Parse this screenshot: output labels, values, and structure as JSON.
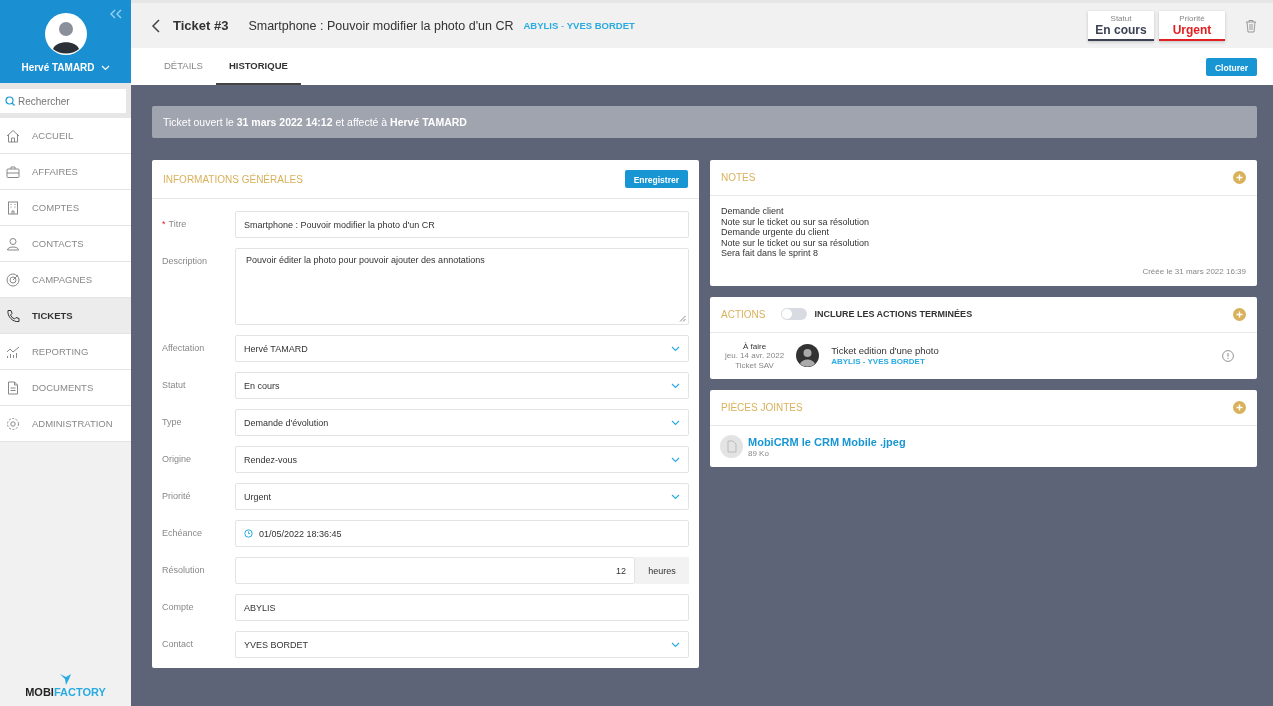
{
  "sidebar": {
    "user_name": "Hervé TAMARD",
    "search": {
      "placeholder": "Rechercher"
    },
    "items": [
      {
        "label": "ACCUEIL",
        "selected": false
      },
      {
        "label": "AFFAIRES",
        "selected": false
      },
      {
        "label": "COMPTES",
        "selected": false
      },
      {
        "label": "CONTACTS",
        "selected": false
      },
      {
        "label": "CAMPAGNES",
        "selected": false
      },
      {
        "label": "TICKETS",
        "selected": true
      },
      {
        "label": "REPORTING",
        "selected": false
      },
      {
        "label": "DOCUMENTS",
        "selected": false
      },
      {
        "label": "ADMINISTRATION",
        "selected": false
      }
    ],
    "logo": {
      "part_1": "MOBI",
      "part_2": "FACTORY"
    }
  },
  "header": {
    "ticket_number": "Ticket #3",
    "title": "Smartphone : Pouvoir modifier la photo d'un CR",
    "company_link": "ABYLIS",
    "separator": " - ",
    "contact_link": "YVES BORDET",
    "badges": [
      {
        "label": "Statut",
        "value": "En cours",
        "color": "#3b4253"
      },
      {
        "label": "Priorité",
        "value": "Urgent",
        "color": "#e02020"
      }
    ]
  },
  "tabs": [
    {
      "label": "DÉTAILS",
      "selected": false
    },
    {
      "label": "HISTORIQUE",
      "selected": true
    }
  ],
  "close_button": "Cloturer",
  "banner": "Ticket ouvert le **31 mars 2022 14:12** et affecté à **Hervé TAMARD**",
  "general_info": {
    "title": "INFORMATIONS GÉNÉRALES",
    "save_button": "Enregistrer",
    "fields": [
      {
        "kind": "text",
        "label": "Titre",
        "required_mark": "*",
        "value": "Smartphone : Pouvoir modifier la photo d'un CR"
      },
      {
        "kind": "textarea",
        "label": "Description",
        "value": "Pouvoir éditer la photo pour  pouvoir ajouter des annotations"
      },
      {
        "kind": "select",
        "label": "Affectation",
        "value": "Hervé TAMARD"
      },
      {
        "kind": "select",
        "label": "Statut",
        "value": "En cours"
      },
      {
        "kind": "select",
        "label": "Type",
        "value": "Demande d'évolution"
      },
      {
        "kind": "select",
        "label": "Origine",
        "value": "Rendez-vous"
      },
      {
        "kind": "select",
        "label": "Priorité",
        "value": "Urgent"
      },
      {
        "kind": "date",
        "label": "Echéance",
        "value": "01/05/2022 18:36:45"
      },
      {
        "kind": "number",
        "label": "Résolution",
        "value": "12",
        "unit": "heures"
      },
      {
        "kind": "text",
        "label": "Compte",
        "value": "ABYLIS"
      },
      {
        "kind": "select",
        "label": "Contact",
        "value": "YVES BORDET"
      }
    ]
  },
  "notes": {
    "title": "NOTES",
    "lines": [
      "Demande client",
      "Note sur le ticket ou sur sa résolution",
      "Demande urgente du client",
      "Note sur le ticket ou sur sa résolution",
      "Sera fait dans le sprint 8"
    ],
    "created": "Créée le 31 mars 2022 16:39"
  },
  "actions": {
    "title": "ACTIONS",
    "toggle_label": "INCLURE LES ACTIONS TERMINÉES",
    "toggle_on": false,
    "items": [
      {
        "status": "À faire",
        "date": "jeu. 14 avr. 2022",
        "type": "Ticket SAV",
        "title": "Ticket edition d'une photo",
        "company_link": "ABYLIS",
        "separator": " - ",
        "contact_link": "YVES BORDET"
      }
    ]
  },
  "attachments": {
    "title": "PIÈCES JOINTES",
    "files": [
      {
        "name": "MobiCRM le CRM Mobile .jpeg",
        "size": "89 Ko"
      }
    ]
  }
}
